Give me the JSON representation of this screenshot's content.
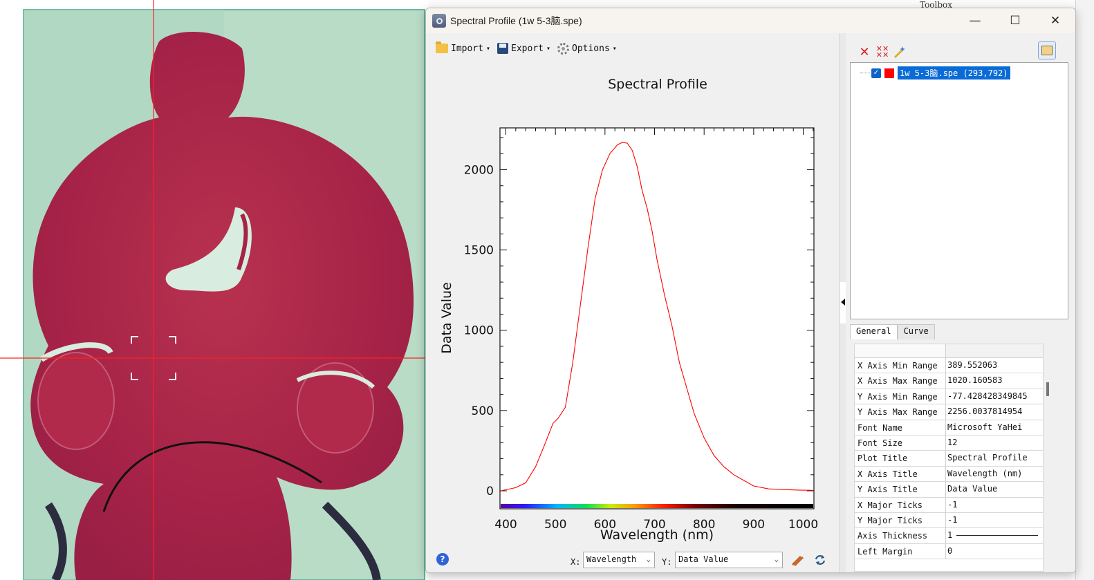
{
  "background": {
    "toolbox_label": "Toolbox"
  },
  "window": {
    "title": "Spectral Profile (1w 5-3脑.spe)",
    "controls": {
      "minimize": "—",
      "maximize": "☐",
      "close": "✕"
    }
  },
  "toolbar": {
    "import_label": "Import",
    "export_label": "Export",
    "options_label": "Options",
    "dropdown_arrow": "▾"
  },
  "chart_data": {
    "type": "line",
    "title": "Spectral Profile",
    "xlabel": "Wavelength (nm)",
    "ylabel": "Data Value",
    "xlim": [
      389.552063,
      1020.160583
    ],
    "ylim": [
      -77.428428349845,
      2256.0037814954
    ],
    "xticks": [
      400,
      500,
      600,
      700,
      800,
      900,
      1000
    ],
    "yticks": [
      0,
      500,
      1000,
      1500,
      2000
    ],
    "grid": false,
    "series": [
      {
        "color": "#ff0000",
        "x": [
          390,
          420,
          440,
          460,
          480,
          495,
          505,
          520,
          535,
          550,
          565,
          580,
          595,
          610,
          625,
          635,
          645,
          655,
          665,
          675,
          685,
          695,
          705,
          720,
          735,
          750,
          765,
          780,
          800,
          820,
          840,
          860,
          880,
          900,
          930,
          960,
          990,
          1020
        ],
        "y": [
          0,
          20,
          50,
          150,
          300,
          420,
          450,
          520,
          800,
          1150,
          1500,
          1820,
          2000,
          2100,
          2155,
          2170,
          2165,
          2120,
          2020,
          1870,
          1760,
          1620,
          1440,
          1220,
          1030,
          800,
          640,
          480,
          330,
          220,
          150,
          100,
          65,
          30,
          12,
          8,
          5,
          3
        ]
      }
    ]
  },
  "bottom": {
    "x_label": "X:",
    "x_value": "Wavelength",
    "y_label": "Y:",
    "y_value": "Data Value",
    "help": "?"
  },
  "tree": {
    "item_label": "1w 5-3脑.spe (293,792)",
    "check": "✓",
    "swatch_color": "#ff0000"
  },
  "tabs": [
    {
      "label": "General"
    },
    {
      "label": "Curve"
    }
  ],
  "properties": [
    {
      "name": "X Axis Min Range",
      "value": "389.552063"
    },
    {
      "name": "X Axis Max Range",
      "value": "1020.160583"
    },
    {
      "name": "Y Axis Min Range",
      "value": "-77.428428349845"
    },
    {
      "name": "Y Axis Max Range",
      "value": "2256.0037814954"
    },
    {
      "name": "Font Name",
      "value": "Microsoft YaHei"
    },
    {
      "name": "Font Size",
      "value": "12"
    },
    {
      "name": "Plot Title",
      "value": "Spectral Profile"
    },
    {
      "name": "X Axis Title",
      "value": "Wavelength (nm)"
    },
    {
      "name": "Y Axis Title",
      "value": "Data Value"
    },
    {
      "name": "X Major Ticks",
      "value": "-1"
    },
    {
      "name": "Y Major Ticks",
      "value": "-1"
    },
    {
      "name": "Axis Thickness",
      "value": "1"
    },
    {
      "name": "Left Margin",
      "value": "0"
    }
  ]
}
